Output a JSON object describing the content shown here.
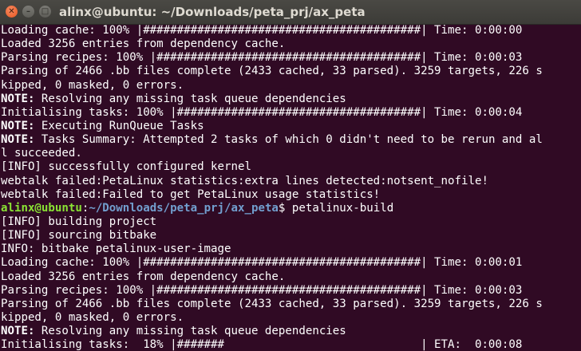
{
  "window": {
    "title": "alinx@ubuntu: ~/Downloads/peta_prj/ax_peta",
    "close_glyph": "✕",
    "minimize_glyph": "–",
    "maximize_glyph": "□"
  },
  "terminal": {
    "prompt": {
      "user_host": "alinx@ubuntu",
      "separator": ":",
      "path": "~/Downloads/peta_prj/ax_peta",
      "suffix": "$ ",
      "command": "petalinux-build"
    },
    "lines": [
      "Loading cache: 100% |#########################################| Time: 0:00:00",
      "Loaded 3256 entries from dependency cache.",
      "Parsing recipes: 100% |#######################################| Time: 0:00:03",
      "Parsing of 2466 .bb files complete (2433 cached, 33 parsed). 3259 targets, 226 s",
      "kipped, 0 masked, 0 errors.",
      {
        "label": "NOTE:",
        "text": " Resolving any missing task queue dependencies"
      },
      "Initialising tasks: 100% |####################################| Time: 0:00:04",
      {
        "label": "NOTE:",
        "text": " Executing RunQueue Tasks"
      },
      {
        "label": "NOTE:",
        "text": " Tasks Summary: Attempted 2 tasks of which 0 didn't need to be rerun and al"
      },
      "l succeeded.",
      "[INFO] successfully configured kernel",
      "webtalk failed:PetaLinux statistics:extra lines detected:notsent_nofile!",
      "webtalk failed:Failed to get PetaLinux usage statistics!",
      "",
      "[INFO] building project",
      "[INFO] sourcing bitbake",
      "INFO: bitbake petalinux-user-image",
      "Loading cache: 100% |#########################################| Time: 0:00:01",
      "Loaded 3256 entries from dependency cache.",
      "Parsing recipes: 100% |#######################################| Time: 0:00:03",
      "Parsing of 2466 .bb files complete (2433 cached, 33 parsed). 3259 targets, 226 s",
      "kipped, 0 masked, 0 errors.",
      {
        "label": "NOTE:",
        "text": " Resolving any missing task queue dependencies"
      },
      "Initialising tasks:  18% |#######                             | ETA:  0:00:08"
    ]
  }
}
